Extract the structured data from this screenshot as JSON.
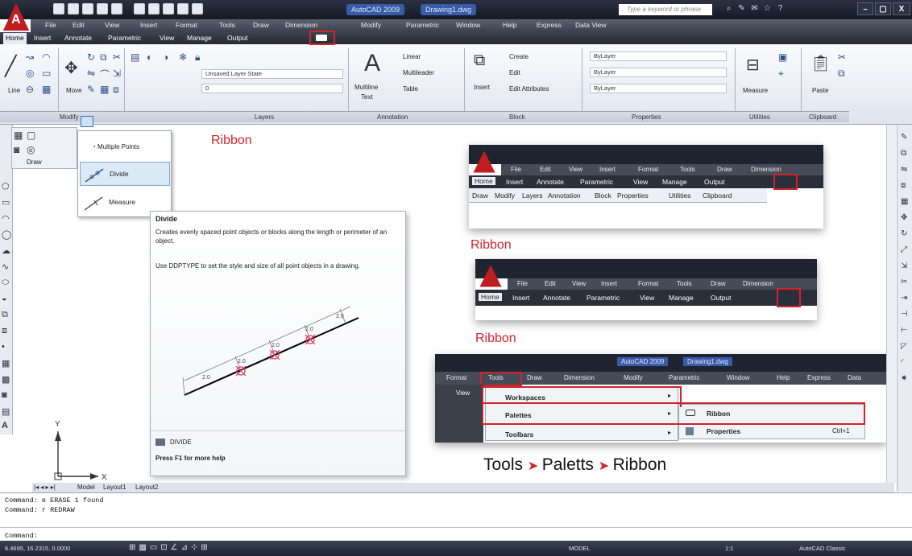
{
  "title_bar": {
    "app_title": "AutoCAD 2009",
    "drawing_title": "Drawing1.dwg",
    "search_placeholder": "Type a keyword or phrase",
    "window_controls": [
      "–",
      "▢",
      "X"
    ]
  },
  "menu": [
    "File",
    "Edit",
    "View",
    "Insert",
    "Format",
    "Tools",
    "Draw",
    "Dimension",
    "Modify",
    "Parametric",
    "Window",
    "Help",
    "Express",
    "Data View"
  ],
  "ribbon_tabs": [
    {
      "label": "Home",
      "active": true
    },
    {
      "label": "Insert"
    },
    {
      "label": "Annotate"
    },
    {
      "label": "Parametric"
    },
    {
      "label": "View"
    },
    {
      "label": "Manage"
    },
    {
      "label": "Output"
    }
  ],
  "ribbon": {
    "draw": {
      "line": "Line",
      "panel": "Draw"
    },
    "modify": {
      "move": "Move",
      "panel": "Modify"
    },
    "layers": {
      "state": "Unsaved Layer State",
      "layer": "0",
      "panel": "Layers"
    },
    "annotation": {
      "multiline": "Multiline",
      "text": "Text",
      "linear": "Linear",
      "multileader": "Multileader",
      "table": "Table",
      "panel": "Annotation"
    },
    "block": {
      "insert": "Insert",
      "create": "Create",
      "edit": "Edit",
      "edit_attributes": "Edit Attributes",
      "panel": "Block"
    },
    "properties": {
      "color": "ByLayer",
      "linetype": "ByLayer",
      "lineweight": "ByLayer",
      "panel": "Properties"
    },
    "utilities": {
      "measure": "Measure",
      "panel": "Utilities"
    },
    "clipboard": {
      "paste": "Paste",
      "panel": "Clipboard"
    }
  },
  "flyout": {
    "multiple_points": "Multiple Points",
    "divide": "Divide",
    "measure": "Measure"
  },
  "tooltip": {
    "title": "Divide",
    "desc": "Creates evenly spaced point objects or blocks along the length or perimeter of an object.",
    "desc2": "Use DDPTYPE to set the style and size of all point objects in a drawing.",
    "command": "DIVIDE",
    "help": "Press F1 for more help",
    "dim_labels": [
      "2.0",
      "2.0",
      "2.0",
      "2.0",
      "2.0"
    ]
  },
  "annotations": {
    "ribbon1": "Ribbon",
    "ribbon2": "Ribbon",
    "ribbon3": "Ribbon",
    "path_tools": "Tools",
    "path_paletts": "Paletts",
    "path_ribbon": "Ribbon"
  },
  "mini1": {
    "menu": [
      "File",
      "Edit",
      "View",
      "Insert",
      "Format",
      "Tools",
      "Draw",
      "Dimension"
    ],
    "tabs": [
      "Home",
      "Insert",
      "Annotate",
      "Parametric",
      "View",
      "Manage",
      "Output"
    ],
    "panels": [
      "Draw",
      "Modify",
      "Layers",
      "Annotation",
      "Block",
      "Properties",
      "Utilities",
      "Clipboard"
    ]
  },
  "mini2": {
    "menu": [
      "File",
      "Edit",
      "View",
      "Insert",
      "Format",
      "Tools",
      "Draw",
      "Dimension"
    ],
    "tabs": [
      "Home",
      "Insert",
      "Annotate",
      "Parametric",
      "View",
      "Manage",
      "Output"
    ]
  },
  "mini3": {
    "app_title": "AutoCAD 2009",
    "drawing_title": "Drawing1.dwg",
    "menu": [
      "Format",
      "Tools",
      "Draw",
      "Dimension",
      "Modify",
      "Parametric",
      "Window",
      "Help",
      "Express",
      "Data"
    ],
    "view": "View",
    "tools_items": [
      "Workspaces",
      "Palettes",
      "Toolbars"
    ],
    "palettes_items": [
      "Ribbon",
      "Properties"
    ],
    "shortcut": "Ctrl+1"
  },
  "layout_tabs": [
    "Model",
    "Layout1",
    "Layout2"
  ],
  "command_lines": [
    "Command: e ERASE 1 found",
    "Command: r REDRAW",
    "Command:"
  ],
  "status": {
    "coords": "6.4695, 16.2315, 0.0000",
    "model": "MODEL",
    "scale": "1:1",
    "workspace": "AutoCAD Classic"
  },
  "colors": {
    "accent_red": "#d2222a",
    "title_dark": "#1d2330",
    "ribbon_bg": "#e8ecf2"
  }
}
